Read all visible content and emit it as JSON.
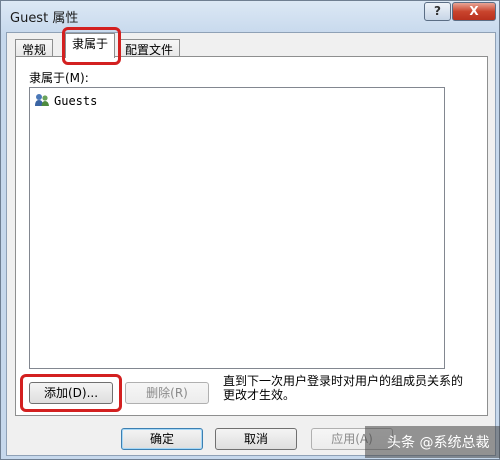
{
  "window": {
    "title": "Guest 属性",
    "help_button": "?",
    "close_button": "X"
  },
  "tabs": [
    {
      "label": "常规",
      "active": false
    },
    {
      "label": "隶属于",
      "active": true
    },
    {
      "label": "配置文件",
      "active": false
    }
  ],
  "member_of": {
    "label": "隶属于(M):",
    "items": [
      {
        "name": "Guests",
        "icon": "group-icon"
      }
    ]
  },
  "actions": {
    "add": "添加(D)...",
    "remove": "删除(R)",
    "note": "直到下一次用户登录时对用户的组成员关系的更改才生效。"
  },
  "footer": {
    "ok": "确定",
    "cancel": "取消",
    "apply": "应用(A)"
  },
  "watermark": "头条 @系统总裁",
  "colors": {
    "highlight": "#d32020",
    "close": "#c9442d"
  }
}
